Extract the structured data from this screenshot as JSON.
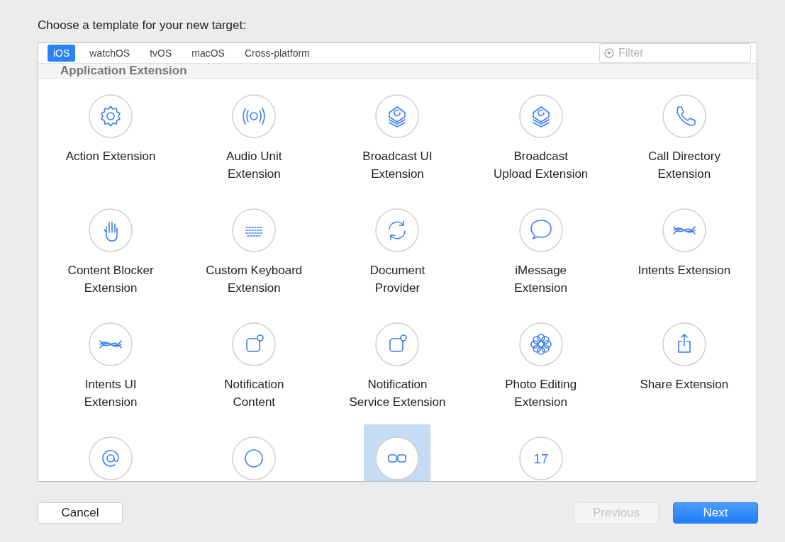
{
  "title": "Choose a template for your new target:",
  "tabs": [
    {
      "label": "iOS",
      "selected": true
    },
    {
      "label": "watchOS",
      "selected": false
    },
    {
      "label": "tvOS",
      "selected": false
    },
    {
      "label": "macOS",
      "selected": false
    },
    {
      "label": "Cross-platform",
      "selected": false
    }
  ],
  "filter": {
    "placeholder": "Filter"
  },
  "section": "Application Extension",
  "templates": [
    {
      "kind": "gear",
      "label": [
        "Action Extension"
      ],
      "selected": false
    },
    {
      "kind": "audio",
      "label": [
        "Audio Unit",
        "Extension"
      ],
      "selected": false
    },
    {
      "kind": "broadcast",
      "label": [
        "Broadcast UI",
        "Extension"
      ],
      "selected": false
    },
    {
      "kind": "broadcast",
      "label": [
        "Broadcast",
        "Upload Extension"
      ],
      "selected": false
    },
    {
      "kind": "phone",
      "label": [
        "Call Directory",
        "Extension"
      ],
      "selected": false
    },
    {
      "kind": "hand",
      "label": [
        "Content Blocker",
        "Extension"
      ],
      "selected": false
    },
    {
      "kind": "keyboard",
      "label": [
        "Custom Keyboard",
        "Extension"
      ],
      "selected": false
    },
    {
      "kind": "sync",
      "label": [
        "Document",
        "Provider"
      ],
      "selected": false
    },
    {
      "kind": "bubble",
      "label": [
        "iMessage",
        "Extension"
      ],
      "selected": false
    },
    {
      "kind": "waves",
      "label": [
        "Intents Extension"
      ],
      "selected": false
    },
    {
      "kind": "waves",
      "label": [
        "Intents UI",
        "Extension"
      ],
      "selected": false
    },
    {
      "kind": "notification",
      "label": [
        "Notification",
        "Content"
      ],
      "selected": false
    },
    {
      "kind": "notification",
      "label": [
        "Notification",
        "Service Extension"
      ],
      "selected": false
    },
    {
      "kind": "flower",
      "label": [
        "Photo Editing",
        "Extension"
      ],
      "selected": false
    },
    {
      "kind": "share",
      "label": [
        "Share Extension"
      ],
      "selected": false
    },
    {
      "kind": "at",
      "selected": false
    },
    {
      "kind": "circle",
      "selected": false
    },
    {
      "kind": "link",
      "selected": true
    },
    {
      "kind": "calendar",
      "glyph": "17",
      "selected": false
    }
  ],
  "buttons": [
    {
      "label": "Cancel",
      "kind": "plain",
      "disabled": false
    },
    {
      "label": "Previous",
      "kind": "plain",
      "disabled": true
    },
    {
      "label": "Next",
      "kind": "primary",
      "disabled": false
    }
  ]
}
